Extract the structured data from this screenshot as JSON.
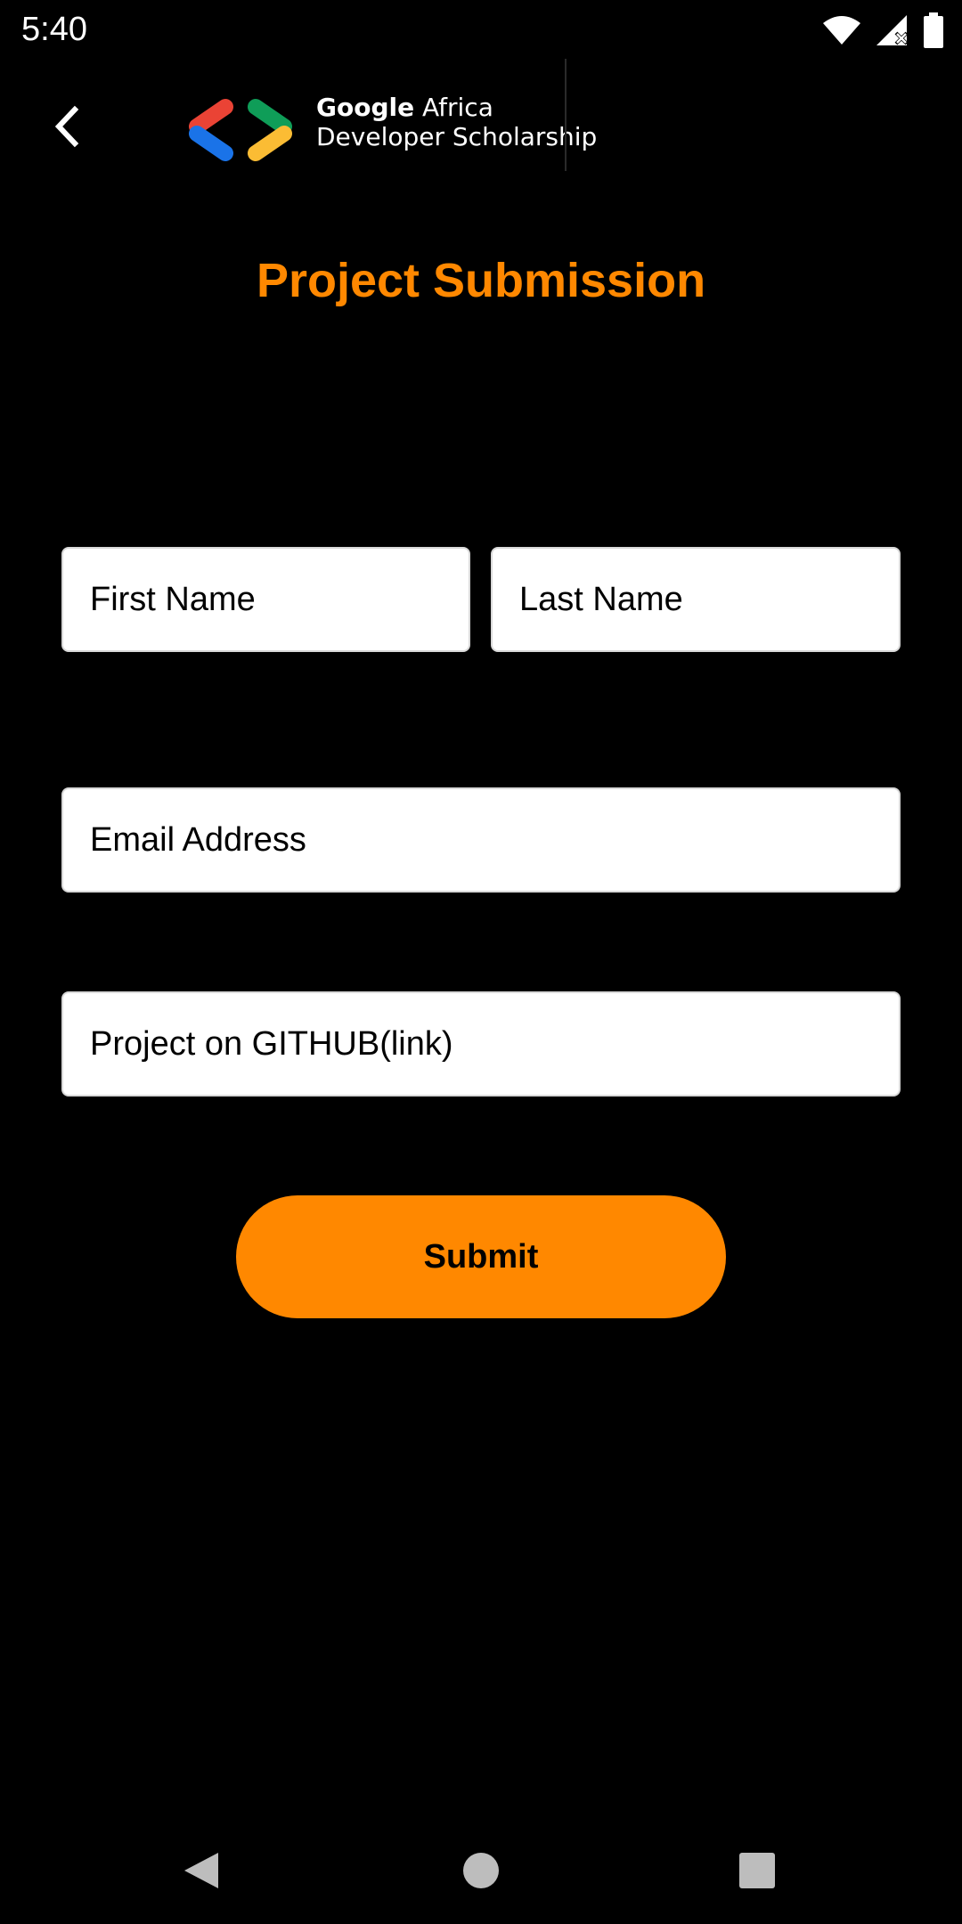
{
  "status_bar": {
    "time": "5:40",
    "icons": [
      "wifi-icon",
      "signal-icon",
      "battery-icon"
    ]
  },
  "app_bar": {
    "back_icon": "chevron-left-icon",
    "brand": {
      "line1_bold": "Google",
      "line1_rest": " Africa",
      "line2": "Developer Scholarship"
    }
  },
  "page": {
    "title": "Project Submission"
  },
  "form": {
    "first_name": {
      "placeholder": "First Name",
      "value": ""
    },
    "last_name": {
      "placeholder": "Last Name",
      "value": ""
    },
    "email": {
      "placeholder": "Email Address",
      "value": ""
    },
    "github": {
      "placeholder": "Project on GITHUB(link)",
      "value": ""
    },
    "submit_label": "Submit"
  },
  "nav_bar": {
    "items": [
      "back-triangle-icon",
      "home-circle-icon",
      "recents-square-icon"
    ]
  },
  "colors": {
    "background": "#000000",
    "accent": "#ff8800",
    "field_background": "#ffffff",
    "logo_red": "#ea4335",
    "logo_blue": "#1a73e8",
    "logo_green": "#0f9d58",
    "logo_yellow": "#fbbc34"
  }
}
